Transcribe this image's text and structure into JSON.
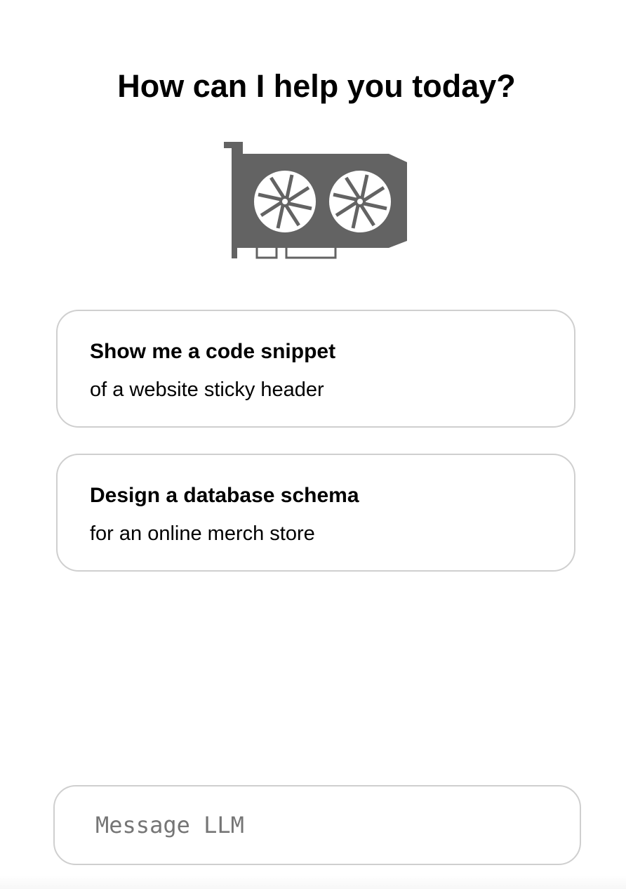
{
  "header": {
    "title": "How can I help you today?"
  },
  "logo": {
    "icon": "graphics-card-icon",
    "color": "#636363"
  },
  "suggestions": [
    {
      "title": "Show me a code snippet",
      "subtitle": "of a website sticky header"
    },
    {
      "title": "Design a database schema",
      "subtitle": "for an online merch store"
    }
  ],
  "composer": {
    "placeholder": "Message LLM",
    "value": ""
  },
  "colors": {
    "border": "#cfcfcf",
    "text": "#000000",
    "placeholder": "#757575"
  }
}
